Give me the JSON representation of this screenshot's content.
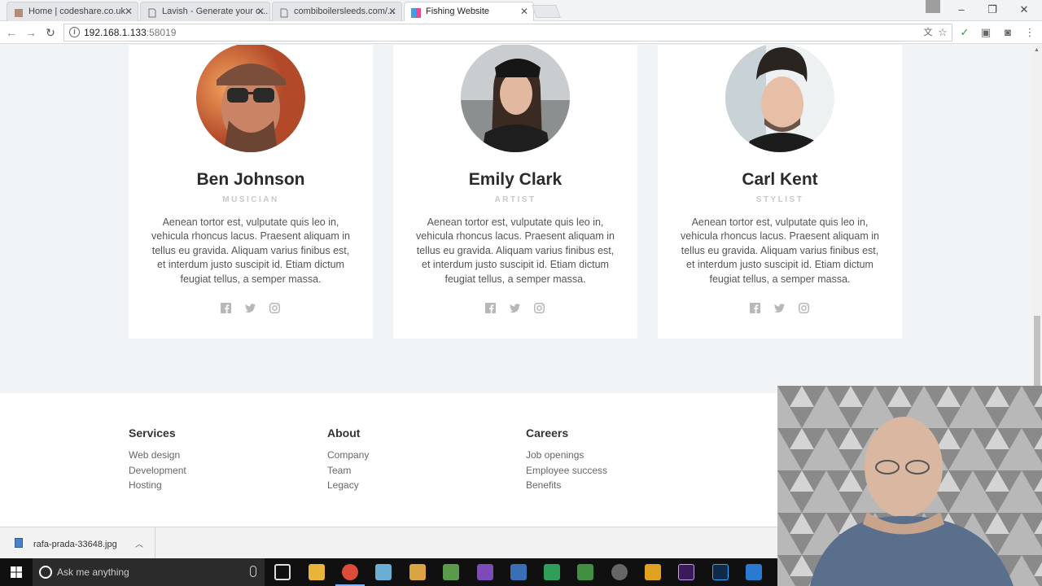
{
  "browser": {
    "tabs": [
      {
        "title": "Home | codeshare.co.uk"
      },
      {
        "title": "Lavish - Generate your o..."
      },
      {
        "title": "combiboilersleeds.com/..."
      },
      {
        "title": "Fishing Website"
      }
    ],
    "url_host": "192.168.1.133",
    "url_port": ":58019"
  },
  "team": [
    {
      "name": "Ben Johnson",
      "role": "MUSICIAN",
      "bio": "Aenean tortor est, vulputate quis leo in, vehicula rhoncus lacus. Praesent aliquam in tellus eu gravida. Aliquam varius finibus est, et interdum justo suscipit id. Etiam dictum feugiat tellus, a semper massa."
    },
    {
      "name": "Emily Clark",
      "role": "ARTIST",
      "bio": "Aenean tortor est, vulputate quis leo in, vehicula rhoncus lacus. Praesent aliquam in tellus eu gravida. Aliquam varius finibus est, et interdum justo suscipit id. Etiam dictum feugiat tellus, a semper massa."
    },
    {
      "name": "Carl Kent",
      "role": "STYLIST",
      "bio": "Aenean tortor est, vulputate quis leo in, vehicula rhoncus lacus. Praesent aliquam in tellus eu gravida. Aliquam varius finibus est, et interdum justo suscipit id. Etiam dictum feugiat tellus, a semper massa."
    }
  ],
  "social_icons": [
    "facebook-icon",
    "twitter-icon",
    "instagram-icon"
  ],
  "footer": {
    "columns": [
      {
        "heading": "Services",
        "links": [
          "Web design",
          "Development",
          "Hosting"
        ]
      },
      {
        "heading": "About",
        "links": [
          "Company",
          "Team",
          "Legacy"
        ]
      },
      {
        "heading": "Careers",
        "links": [
          "Job openings",
          "Employee success",
          "Benefits"
        ]
      }
    ]
  },
  "downloads": {
    "file_name": "rafa-prada-33648.jpg"
  },
  "taskbar": {
    "search_placeholder": "Ask me anything"
  },
  "colors": {
    "page_bg": "#f0f4f7",
    "card_bg": "#ffffff",
    "role_text": "#c8c8c8",
    "taskbar": "#101010"
  }
}
